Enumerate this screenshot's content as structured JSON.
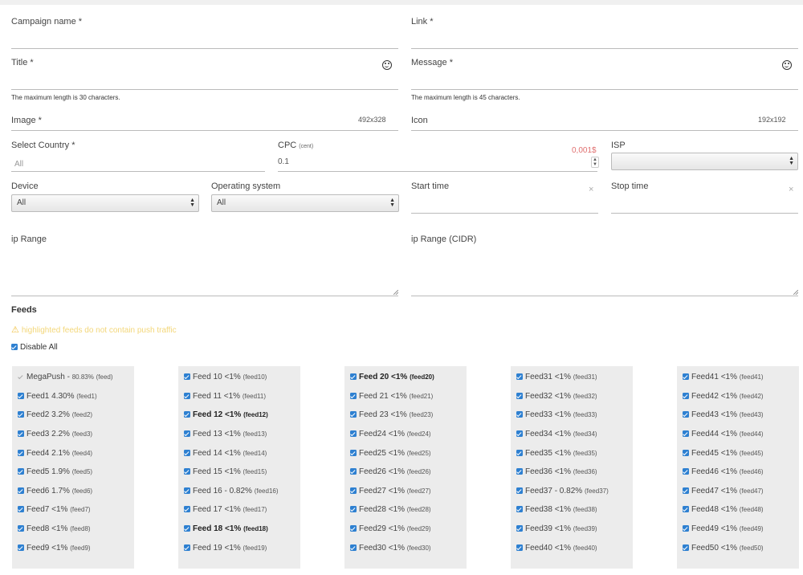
{
  "form": {
    "campaign_name": {
      "label": "Campaign name *"
    },
    "link": {
      "label": "Link *"
    },
    "title": {
      "label": "Title *",
      "hint": "The maximum length is 30 characters."
    },
    "message": {
      "label": "Message *",
      "hint": "The maximum length is 45 characters."
    },
    "image": {
      "label": "Image *",
      "dimensions": "492x328"
    },
    "icon": {
      "label": "Icon",
      "dimensions": "192x192"
    },
    "country": {
      "label": "Select Country *",
      "placeholder": "All"
    },
    "cpc": {
      "label": "CPC",
      "unit": "(cent)",
      "value": "0.1",
      "price": "0,001$"
    },
    "isp": {
      "label": "ISP",
      "value": ""
    },
    "device": {
      "label": "Device",
      "value": "All"
    },
    "os": {
      "label": "Operating system",
      "value": "All"
    },
    "start_time": {
      "label": "Start time",
      "clear": "×"
    },
    "stop_time": {
      "label": "Stop time",
      "clear": "×"
    },
    "ip_range": {
      "label": "ip Range"
    },
    "ip_range_cidr": {
      "label": "ip Range (CIDR)"
    }
  },
  "feeds": {
    "title": "Feeds",
    "warning": "highlighted feeds do not contain push traffic",
    "disable_all": "Disable All",
    "columns": [
      [
        {
          "text": "MegaPush - ",
          "pct": "80.83%",
          "id": "(feed)",
          "checked": false,
          "bold": false
        },
        {
          "text": "Feed1 4.30%",
          "id": "(feed1)",
          "checked": true,
          "bold": false
        },
        {
          "text": "Feed2 3.2%",
          "id": "(feed2)",
          "checked": true,
          "bold": false
        },
        {
          "text": "Feed3 2.2%",
          "id": "(feed3)",
          "checked": true,
          "bold": false
        },
        {
          "text": "Feed4 2.1%",
          "id": "(feed4)",
          "checked": true,
          "bold": false
        },
        {
          "text": "Feed5 1.9%",
          "id": "(feed5)",
          "checked": true,
          "bold": false
        },
        {
          "text": "Feed6 1.7%",
          "id": "(feed6)",
          "checked": true,
          "bold": false
        },
        {
          "text": "Feed7 <1%",
          "id": "(feed7)",
          "checked": true,
          "bold": false
        },
        {
          "text": "Feed8 <1%",
          "id": "(feed8)",
          "checked": true,
          "bold": false
        },
        {
          "text": "Feed9 <1%",
          "id": "(feed9)",
          "checked": true,
          "bold": false
        }
      ],
      [
        {
          "text": "Feed 10 <1%",
          "id": "(feed10)",
          "checked": true,
          "bold": false
        },
        {
          "text": "Feed 11 <1%",
          "id": "(feed11)",
          "checked": true,
          "bold": false
        },
        {
          "text": "Feed 12 <1%",
          "id": "(feed12)",
          "checked": true,
          "bold": true
        },
        {
          "text": "Feed 13 <1%",
          "id": "(feed13)",
          "checked": true,
          "bold": false
        },
        {
          "text": "Feed 14 <1%",
          "id": "(feed14)",
          "checked": true,
          "bold": false
        },
        {
          "text": "Feed 15 <1%",
          "id": "(feed15)",
          "checked": true,
          "bold": false
        },
        {
          "text": "Feed 16 - 0.82%",
          "id": "(feed16)",
          "checked": true,
          "bold": false
        },
        {
          "text": "Feed 17 <1%",
          "id": "(feed17)",
          "checked": true,
          "bold": false
        },
        {
          "text": "Feed 18 <1%",
          "id": "(feed18)",
          "checked": true,
          "bold": true
        },
        {
          "text": "Feed 19 <1%",
          "id": "(feed19)",
          "checked": true,
          "bold": false
        }
      ],
      [
        {
          "text": "Feed 20 <1%",
          "id": "(feed20)",
          "checked": true,
          "bold": true
        },
        {
          "text": "Feed 21 <1%",
          "id": "(feed21)",
          "checked": true,
          "bold": false
        },
        {
          "text": "Feed 23 <1%",
          "id": "(feed23)",
          "checked": true,
          "bold": false
        },
        {
          "text": "Feed24 <1%",
          "id": "(feed24)",
          "checked": true,
          "bold": false
        },
        {
          "text": "Feed25 <1%",
          "id": "(feed25)",
          "checked": true,
          "bold": false
        },
        {
          "text": "Feed26 <1%",
          "id": "(feed26)",
          "checked": true,
          "bold": false
        },
        {
          "text": "Feed27 <1%",
          "id": "(feed27)",
          "checked": true,
          "bold": false
        },
        {
          "text": "Feed28 <1%",
          "id": "(feed28)",
          "checked": true,
          "bold": false
        },
        {
          "text": "Feed29 <1%",
          "id": "(feed29)",
          "checked": true,
          "bold": false
        },
        {
          "text": "Feed30 <1%",
          "id": "(feed30)",
          "checked": true,
          "bold": false
        }
      ],
      [
        {
          "text": "Feed31 <1%",
          "id": "(feed31)",
          "checked": true,
          "bold": false
        },
        {
          "text": "Feed32 <1%",
          "id": "(feed32)",
          "checked": true,
          "bold": false
        },
        {
          "text": "Feed33 <1%",
          "id": "(feed33)",
          "checked": true,
          "bold": false
        },
        {
          "text": "Feed34 <1%",
          "id": "(feed34)",
          "checked": true,
          "bold": false
        },
        {
          "text": "Feed35 <1%",
          "id": "(feed35)",
          "checked": true,
          "bold": false
        },
        {
          "text": "Feed36 <1%",
          "id": "(feed36)",
          "checked": true,
          "bold": false
        },
        {
          "text": "Feed37 - 0.82%",
          "id": "(feed37)",
          "checked": true,
          "bold": false
        },
        {
          "text": "Feed38 <1%",
          "id": "(feed38)",
          "checked": true,
          "bold": false
        },
        {
          "text": "Feed39 <1%",
          "id": "(feed39)",
          "checked": true,
          "bold": false
        },
        {
          "text": "Feed40 <1%",
          "id": "(feed40)",
          "checked": true,
          "bold": false
        }
      ],
      [
        {
          "text": "Feed41 <1%",
          "id": "(feed41)",
          "checked": true,
          "bold": false
        },
        {
          "text": "Feed42 <1%",
          "id": "(feed42)",
          "checked": true,
          "bold": false
        },
        {
          "text": "Feed43 <1%",
          "id": "(feed43)",
          "checked": true,
          "bold": false
        },
        {
          "text": "Feed44 <1%",
          "id": "(feed44)",
          "checked": true,
          "bold": false
        },
        {
          "text": "Feed45 <1%",
          "id": "(feed45)",
          "checked": true,
          "bold": false
        },
        {
          "text": "Feed46 <1%",
          "id": "(feed46)",
          "checked": true,
          "bold": false
        },
        {
          "text": "Feed47 <1%",
          "id": "(feed47)",
          "checked": true,
          "bold": false
        },
        {
          "text": "Feed48 <1%",
          "id": "(feed48)",
          "checked": true,
          "bold": false
        },
        {
          "text": "Feed49 <1%",
          "id": "(feed49)",
          "checked": true,
          "bold": false
        },
        {
          "text": "Feed50 <1%",
          "id": "(feed50)",
          "checked": true,
          "bold": false
        }
      ]
    ]
  },
  "colors": {
    "checkbox": "#2e80d1",
    "warning": "#f3d77a",
    "price": "#e07070",
    "feed_column_bg": "#ececec"
  },
  "icons": {
    "emoji": "smiley-icon",
    "warning": "warning-icon",
    "select_arrows": "select-arrows-icon",
    "clear": "clear-icon",
    "checkbox": "checkbox-icon",
    "resize": "resize-grip-icon"
  }
}
